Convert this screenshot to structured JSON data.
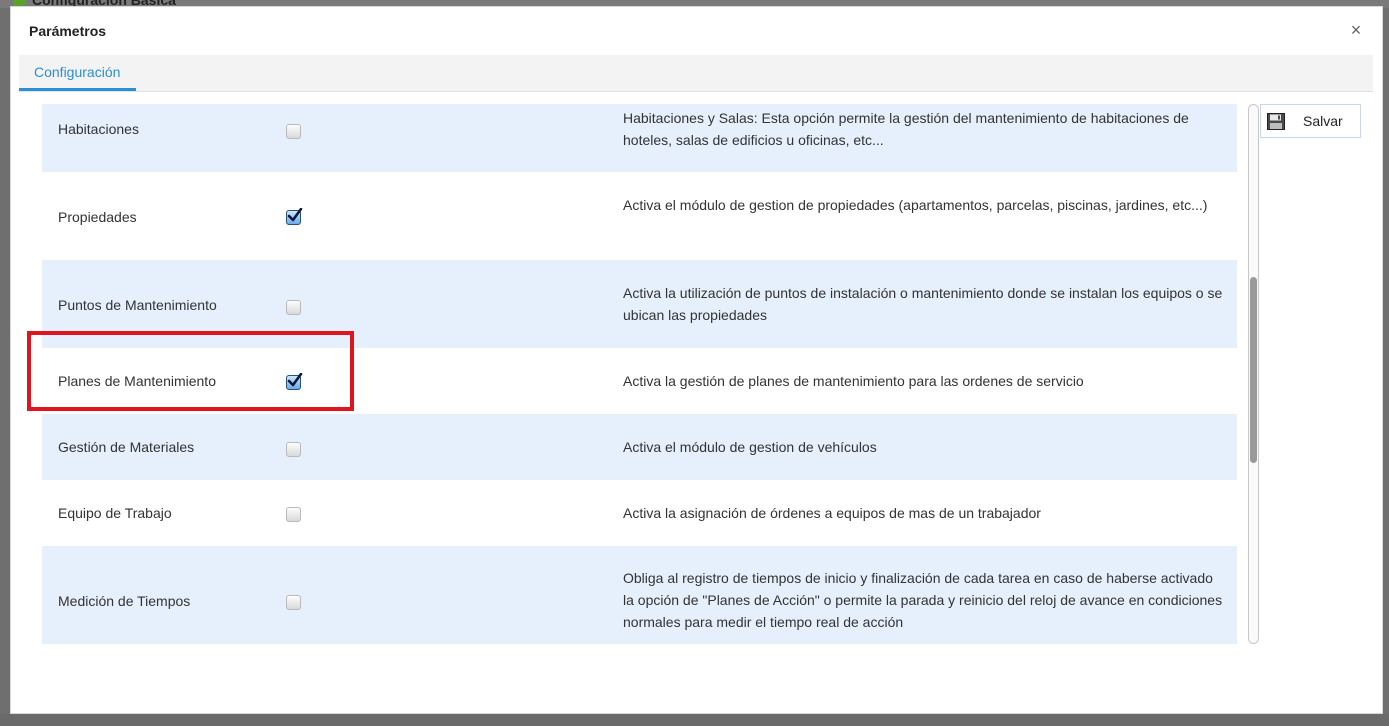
{
  "background": {
    "title": "Configuración Básica"
  },
  "dialog": {
    "title": "Parámetros",
    "close_glyph": "×"
  },
  "tabs": [
    {
      "label": "Configuración",
      "active": true
    }
  ],
  "actions": {
    "save_label": "Salvar"
  },
  "rows": [
    {
      "label": "Habitaciones",
      "checked": false,
      "description": "Habitaciones y Salas: Esta opción permite la gestión del mantenimiento de habitaciones de hoteles, salas de edificios u oficinas, etc..."
    },
    {
      "label": "Propiedades",
      "checked": true,
      "description": "Activa el módulo de gestion de propiedades (apartamentos, parcelas, piscinas, jardines, etc...)"
    },
    {
      "label": "Puntos de Mantenimiento",
      "checked": false,
      "description": "Activa la utilización de puntos de instalación o mantenimiento donde se instalan los equipos o se ubican las propiedades"
    },
    {
      "label": "Planes de Mantenimiento",
      "checked": true,
      "description": "Activa la gestión de planes de mantenimiento para las ordenes de servicio"
    },
    {
      "label": "Gestión de Materiales",
      "checked": false,
      "description": "Activa el módulo de gestion de vehículos"
    },
    {
      "label": "Equipo de Trabajo",
      "checked": false,
      "description": "Activa la asignación de órdenes a equipos de mas de un trabajador"
    },
    {
      "label": "Medición de Tiempos",
      "checked": false,
      "description": "Obliga al registro de tiempos de inicio y finalización de cada tarea en caso de haberse activado la opción de \"Planes de Acción\" o permite la parada y reinicio del reloj de avance en condiciones normales para medir el tiempo real de acción"
    }
  ],
  "colors": {
    "accent": "#2b8ed6",
    "row_alt": "#e6f0fc",
    "highlight": "#e0141e"
  }
}
